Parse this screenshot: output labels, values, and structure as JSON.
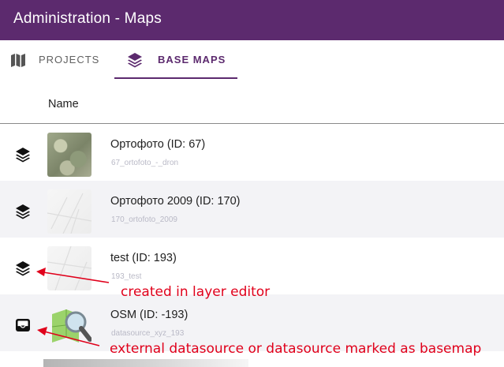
{
  "app": {
    "title": "Administration - Maps"
  },
  "tabs": [
    {
      "label": "PROJECTS",
      "icon": "map-icon",
      "active": false
    },
    {
      "label": "BASE MAPS",
      "icon": "layers-icon",
      "active": true
    }
  ],
  "table": {
    "column_name": "Name",
    "rows": [
      {
        "title": "Ортофото (ID: 67)",
        "subtitle": "67_ortofoto_-_dron",
        "icon": "layers-icon"
      },
      {
        "title": "Ортофото 2009 (ID: 170)",
        "subtitle": "170_ortofoto_2009",
        "icon": "layers-icon"
      },
      {
        "title": "test (ID: 193)",
        "subtitle": "193_test",
        "icon": "layers-icon"
      },
      {
        "title": "OSM (ID: -193)",
        "subtitle": "datasource_xyz_193",
        "icon": "inbox-icon"
      }
    ]
  },
  "annotations": {
    "layer_editor": "created in layer editor",
    "external": "external datasource or datasource marked as basemap"
  },
  "colors": {
    "primary": "#5c2a6e",
    "annotation": "#e0001b",
    "row_alt": "#f3f3f6"
  }
}
